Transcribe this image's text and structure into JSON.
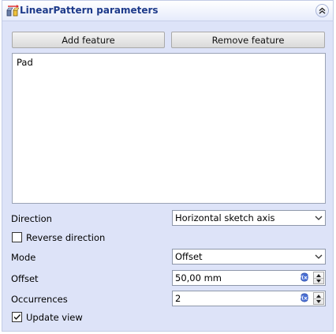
{
  "header": {
    "title": "LinearPattern parameters",
    "icon": "linear-pattern-icon",
    "collapse_icon": "double-chevron-up-icon"
  },
  "buttons": {
    "add_feature": "Add feature",
    "remove_feature": "Remove feature"
  },
  "features": [
    "Pad"
  ],
  "direction": {
    "label": "Direction",
    "value": "Horizontal sketch axis"
  },
  "reverse_direction": {
    "label": "Reverse direction",
    "checked": false
  },
  "mode": {
    "label": "Mode",
    "value": "Offset"
  },
  "offset": {
    "label": "Offset",
    "value": "50,00 mm"
  },
  "occurrences": {
    "label": "Occurrences",
    "value": "2"
  },
  "update_view": {
    "label": "Update view",
    "checked": true
  },
  "colors": {
    "panel_bg": "#dde3f8",
    "title_text": "#1d3a8a",
    "expression_icon": "#4a6fd3"
  }
}
